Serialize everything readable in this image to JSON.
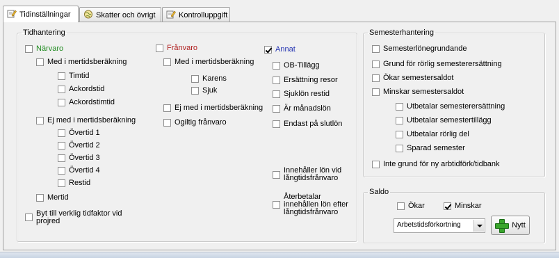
{
  "tabs": [
    {
      "label": "Tidinställningar",
      "icon": "edit-icon"
    },
    {
      "label": "Skatter och övrigt",
      "icon": "globe-icon"
    },
    {
      "label": "Kontrolluppgift",
      "icon": "edit-icon"
    }
  ],
  "tidhantering": {
    "legend": "Tidhantering",
    "narvaro": {
      "label": "Närvaro",
      "checked": false,
      "med": "Med i mertidsberäkning",
      "med_items": [
        "Timtid",
        "Ackordstid",
        "Ackordstimtid"
      ],
      "ej_med": "Ej med i mertidsberäkning",
      "ej_items": [
        "Övertid 1",
        "Övertid 2",
        "Övertid 3",
        "Övertid 4",
        "Restid"
      ],
      "mertid": "Mertid"
    },
    "franvaro": {
      "label": "Frånvaro",
      "checked": false,
      "med": "Med i mertidsberäkning",
      "med_items": [
        "Karens",
        "Sjuk"
      ],
      "ej_med": "Ej med i mertidsberäkning",
      "ogiltig": "Ogiltig frånvaro"
    },
    "annat": {
      "label": "Annat",
      "checked": true,
      "items": [
        "OB-Tillägg",
        "Ersättning resor",
        "Sjuklön restid",
        "Är månadslön",
        "Endast på slutlön"
      ],
      "innehaller": "Innehåller lön vid långtidsfrånvaro",
      "aterbetalar": "Återbetalar innehållen lön efter långtidsfrånvaro"
    },
    "byt": "Byt till verklig tidfaktor vid projred"
  },
  "semester": {
    "legend": "Semesterhantering",
    "items": [
      "Semesterlönegrundande",
      "Grund för rörlig semesterersättning",
      "Ökar semestersaldot",
      "Minskar semestersaldot"
    ],
    "sub_items": [
      "Utbetalar semesterersättning",
      "Utbetalar semestertillägg",
      "Utbetalar rörlig del",
      "Sparad semester"
    ],
    "inte_grund": "Inte grund för ny arbtidförk/tidbank"
  },
  "saldo": {
    "legend": "Saldo",
    "okar": {
      "label": "Ökar",
      "checked": false
    },
    "minskar": {
      "label": "Minskar",
      "checked": true
    },
    "select_value": "Arbetstidsförkortning",
    "button_label": "Nytt"
  }
}
